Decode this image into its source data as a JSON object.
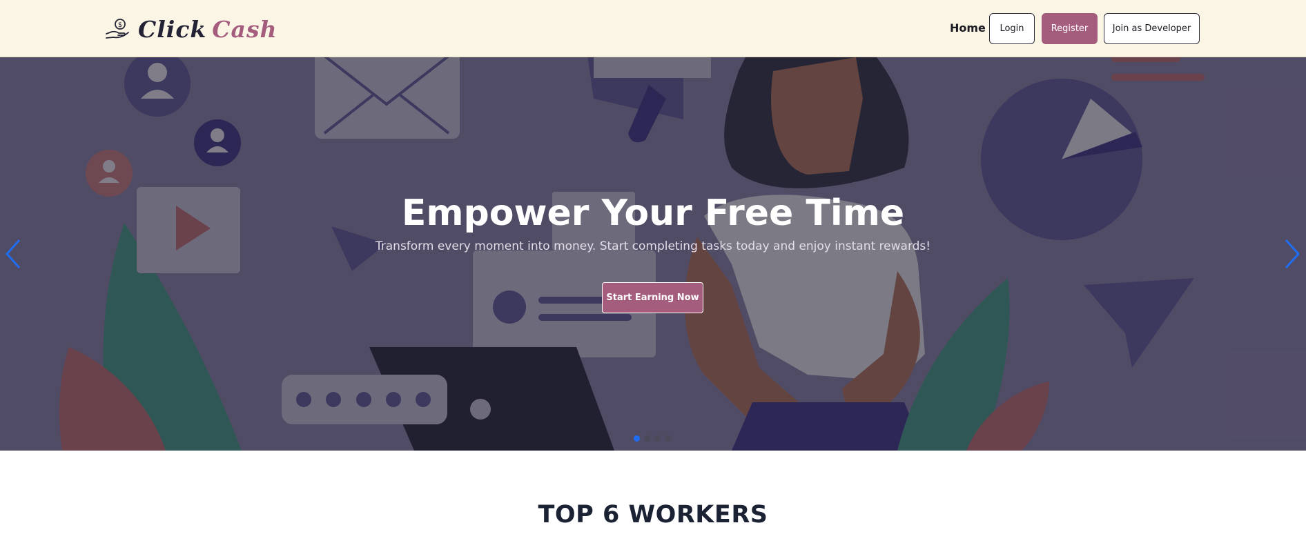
{
  "navbar": {
    "brand": {
      "word1": "Click",
      "word2": "Cash",
      "logo_icon": "money-hand-icon"
    },
    "links": {
      "home": "Home"
    },
    "buttons": {
      "login": "Login",
      "register": "Register",
      "developer": "Join as Developer"
    }
  },
  "hero": {
    "title": "Empower Your Free Time",
    "subtitle": "Transform every moment into money. Start completing tasks today and enjoy instant rewards!",
    "cta": "Start Earning Now",
    "prev_icon": "chevron-left-icon",
    "next_icon": "chevron-right-icon",
    "slide_count": 4,
    "active_slide": 1
  },
  "section": {
    "title": "TOP 6 WORKERS"
  },
  "colors": {
    "navbar_bg": "#fbf5e5",
    "accent": "#a55d7d",
    "dark_text": "#1a2233",
    "carousel_indicator_active": "#1e6df2"
  }
}
